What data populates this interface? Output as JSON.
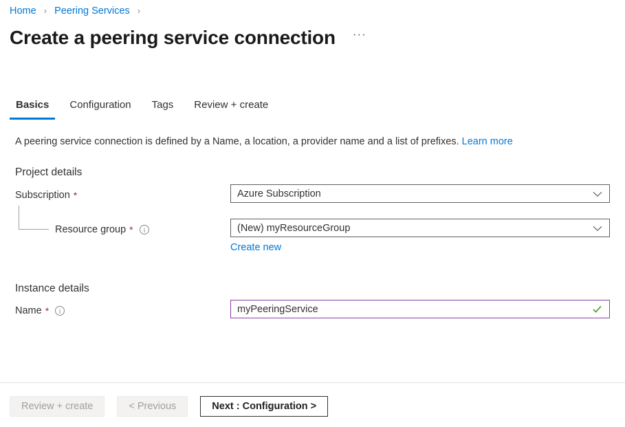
{
  "breadcrumb": {
    "items": [
      {
        "label": "Home"
      },
      {
        "label": "Peering Services"
      }
    ],
    "separator": "›"
  },
  "header": {
    "title": "Create a peering service connection",
    "more_options_label": "···"
  },
  "tabs": [
    {
      "label": "Basics",
      "active": true
    },
    {
      "label": "Configuration",
      "active": false
    },
    {
      "label": "Tags",
      "active": false
    },
    {
      "label": "Review + create",
      "active": false
    }
  ],
  "description": {
    "text": "A peering service connection is defined by a Name, a location, a provider name and a list of prefixes.",
    "link_label": "Learn more"
  },
  "project_details": {
    "heading": "Project details",
    "subscription": {
      "label": "Subscription",
      "required_marker": "*",
      "value": "Azure Subscription"
    },
    "resource_group": {
      "label": "Resource group",
      "required_marker": "*",
      "value": "(New) myResourceGroup",
      "create_new_label": "Create new"
    }
  },
  "instance_details": {
    "heading": "Instance details",
    "name": {
      "label": "Name",
      "required_marker": "*",
      "value": "myPeeringService",
      "placeholder": ""
    }
  },
  "footer": {
    "review_create_label": "Review + create",
    "previous_label": "< Previous",
    "next_label": "Next : Configuration >"
  },
  "colors": {
    "accent": "#0078d4",
    "required": "#a4262c",
    "focus_border": "#8a3ba5",
    "valid_check": "#4f9d2c",
    "text": "#323130"
  }
}
